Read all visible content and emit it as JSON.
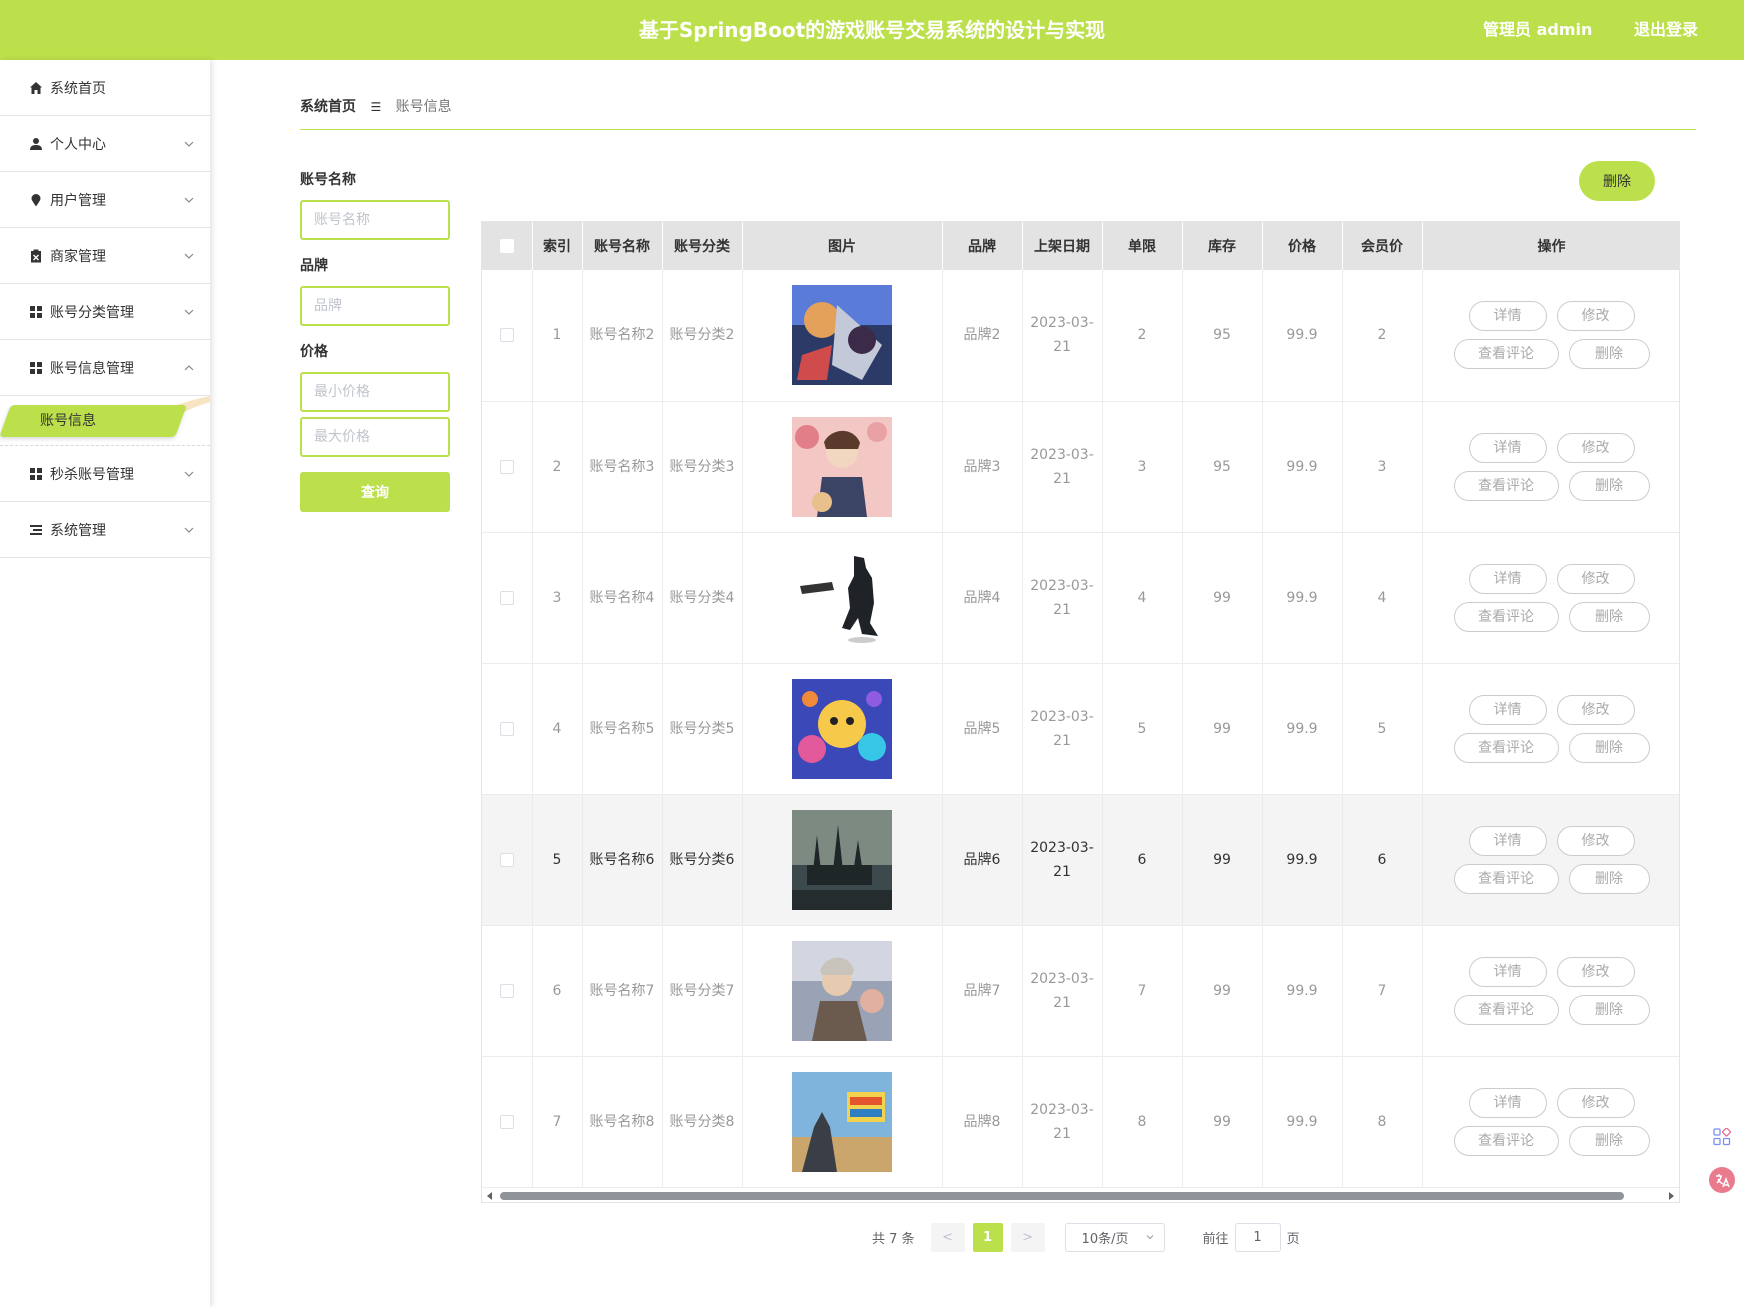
{
  "header": {
    "title": "基于SpringBoot的游戏账号交易系统的设计与实现",
    "user": "管理员 admin",
    "logout": "退出登录"
  },
  "sidebar": {
    "items": [
      {
        "label": "系统首页",
        "icon": "home-icon",
        "has_chevron": false
      },
      {
        "label": "个人中心",
        "icon": "user-icon",
        "has_chevron": true
      },
      {
        "label": "用户管理",
        "icon": "pin-icon",
        "has_chevron": true
      },
      {
        "label": "商家管理",
        "icon": "clipboard-icon",
        "has_chevron": true
      },
      {
        "label": "账号分类管理",
        "icon": "grid-icon",
        "has_chevron": true
      },
      {
        "label": "账号信息管理",
        "icon": "grid-icon",
        "has_chevron": true,
        "expanded": true
      },
      {
        "label": "秒杀账号管理",
        "icon": "grid-icon",
        "has_chevron": true
      },
      {
        "label": "系统管理",
        "icon": "list-icon",
        "has_chevron": true
      }
    ],
    "active_sub": "账号信息"
  },
  "breadcrumb": {
    "home": "系统首页",
    "separator": "☰",
    "current": "账号信息"
  },
  "filters": {
    "name_label": "账号名称",
    "name_placeholder": "账号名称",
    "brand_label": "品牌",
    "brand_placeholder": "品牌",
    "price_label": "价格",
    "min_price_placeholder": "最小价格",
    "max_price_placeholder": "最大价格",
    "search_button": "查询"
  },
  "toolbar": {
    "delete_label": "删除"
  },
  "table": {
    "columns": [
      "索引",
      "账号名称",
      "账号分类",
      "图片",
      "品牌",
      "上架日期",
      "单限",
      "库存",
      "价格",
      "会员价",
      "操作"
    ],
    "actions": {
      "detail": "详情",
      "edit": "修改",
      "comments": "查看评论",
      "delete": "删除"
    },
    "rows": [
      {
        "index": "1",
        "name": "账号名称2",
        "category": "账号分类2",
        "brand": "品牌2",
        "date": "2023-03-21",
        "limit": "2",
        "stock": "95",
        "price": "99.9",
        "member_price": "2"
      },
      {
        "index": "2",
        "name": "账号名称3",
        "category": "账号分类3",
        "brand": "品牌3",
        "date": "2023-03-21",
        "limit": "3",
        "stock": "95",
        "price": "99.9",
        "member_price": "3"
      },
      {
        "index": "3",
        "name": "账号名称4",
        "category": "账号分类4",
        "brand": "品牌4",
        "date": "2023-03-21",
        "limit": "4",
        "stock": "99",
        "price": "99.9",
        "member_price": "4"
      },
      {
        "index": "4",
        "name": "账号名称5",
        "category": "账号分类5",
        "brand": "品牌5",
        "date": "2023-03-21",
        "limit": "5",
        "stock": "99",
        "price": "99.9",
        "member_price": "5"
      },
      {
        "index": "5",
        "name": "账号名称6",
        "category": "账号分类6",
        "brand": "品牌6",
        "date": "2023-03-21",
        "limit": "6",
        "stock": "99",
        "price": "99.9",
        "member_price": "6"
      },
      {
        "index": "6",
        "name": "账号名称7",
        "category": "账号分类7",
        "brand": "品牌7",
        "date": "2023-03-21",
        "limit": "7",
        "stock": "99",
        "price": "99.9",
        "member_price": "7"
      },
      {
        "index": "7",
        "name": "账号名称8",
        "category": "账号分类8",
        "brand": "品牌8",
        "date": "2023-03-21",
        "limit": "8",
        "stock": "99",
        "price": "99.9",
        "member_price": "8"
      }
    ]
  },
  "pagination": {
    "total": "共 7 条",
    "prev": "<",
    "current_page": "1",
    "next": ">",
    "page_size": "10条/页",
    "goto_label": "前往",
    "goto_value": "1",
    "page_suffix": "页"
  },
  "colors": {
    "accent": "#bce04b",
    "header_bg": "#bce04b",
    "table_header_bg": "#e3e3e3"
  }
}
